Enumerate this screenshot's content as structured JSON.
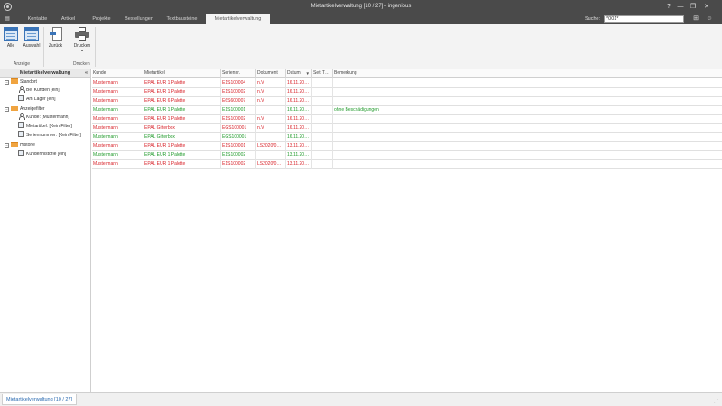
{
  "window": {
    "title": "Mietartikelverwaltung [10 / 27] - ingenious"
  },
  "menu": {
    "tabs": [
      "Kontakte",
      "Artikel",
      "Projekte",
      "Bestellungen",
      "Textbausteine",
      "Mietartikelverwaltung"
    ],
    "active_tab": "Mietartikelverwaltung",
    "search_label": "Suche:",
    "search_value": "*001*"
  },
  "ribbon": {
    "buttons": {
      "alle": "Alle",
      "auswahl": "Auswahl",
      "zurueck": "Zurück",
      "drucken": "Drucken"
    },
    "groups": {
      "anzeige": "Anzeige",
      "drucken": "Drucken"
    }
  },
  "sidebar": {
    "title": "Mietartikelverwaltung",
    "collapse": "«",
    "tree": [
      {
        "label": "Standort",
        "icon": "folder-icon",
        "level": 0,
        "toggle": "−"
      },
      {
        "label": "Bei Kunden [ein]",
        "icon": "person-icon",
        "level": 1
      },
      {
        "label": "Am Lager [ein]",
        "icon": "storage-icon",
        "level": 1
      },
      {
        "label": "Anzeigefilter",
        "icon": "folder-icon",
        "level": 0,
        "toggle": "−"
      },
      {
        "label": "Kunde: [Mustermann]",
        "icon": "person-icon",
        "level": 1
      },
      {
        "label": "Mietartikel: [Kein Filter]",
        "icon": "article-icon",
        "level": 1
      },
      {
        "label": "Seriennummer: [Kein Filter]",
        "icon": "serial-icon",
        "level": 1
      },
      {
        "label": "Historie",
        "icon": "folder-icon",
        "level": 0,
        "toggle": "−"
      },
      {
        "label": "Kundenhistorie [ein]",
        "icon": "history-icon",
        "level": 1
      }
    ]
  },
  "grid": {
    "columns": [
      "Kunde",
      "Mietartikel",
      "Seriennr.",
      "Dokument",
      "Datum",
      "Seit T…",
      "Bemerkung"
    ],
    "sort_column": "Datum",
    "sort_indicator": "▼",
    "rows": [
      {
        "color": "red",
        "cells": [
          "Mustermann",
          "EPAL EUR 1 Palette",
          "E1S100004",
          "n.V",
          "16.11.20…",
          "",
          ""
        ]
      },
      {
        "color": "red",
        "cells": [
          "Mustermann",
          "EPAL EUR 1 Palette",
          "E1S100002",
          "n.V",
          "16.11.20…",
          "",
          ""
        ]
      },
      {
        "color": "red",
        "cells": [
          "Mustermann",
          "EPAL EUR 6 Palette",
          "E6S600007",
          "n.V",
          "16.11.20…",
          "",
          ""
        ]
      },
      {
        "color": "green",
        "cells": [
          "Mustermann",
          "EPAL EUR 1 Palette",
          "E1S100001",
          "",
          "16.11.20…",
          "",
          "ohne Beschädigungen"
        ]
      },
      {
        "color": "red",
        "cells": [
          "Mustermann",
          "EPAL EUR 1 Palette",
          "E1S100002",
          "n.V",
          "16.11.20…",
          "",
          ""
        ]
      },
      {
        "color": "red",
        "cells": [
          "Mustermann",
          "EPAL Gitterbox",
          "EGS100001",
          "n.V",
          "16.11.20…",
          "",
          ""
        ]
      },
      {
        "color": "green",
        "cells": [
          "Mustermann",
          "EPAL Gitterbox",
          "EGS100001",
          "",
          "16.11.20…",
          "",
          ""
        ]
      },
      {
        "color": "red",
        "cells": [
          "Mustermann",
          "EPAL EUR 1 Palette",
          "E1S100001",
          "LS2020/0…",
          "13.11.20…",
          "",
          ""
        ]
      },
      {
        "color": "green",
        "cells": [
          "Mustermann",
          "EPAL EUR 1 Palette",
          "E1S100002",
          "",
          "13.11.20…",
          "",
          ""
        ]
      },
      {
        "color": "red",
        "cells": [
          "Mustermann",
          "EPAL EUR 1 Palette",
          "E1S100002",
          "LS2020/0…",
          "13.11.20…",
          "",
          ""
        ]
      }
    ]
  },
  "status": {
    "tab_label": "Mietartikelverwaltung [10 / 27]"
  },
  "colors": {
    "titlebar": "#4a4a4a",
    "row_red": "#d8232a",
    "row_green": "#1f9a2a",
    "accent": "#3a74b8"
  }
}
